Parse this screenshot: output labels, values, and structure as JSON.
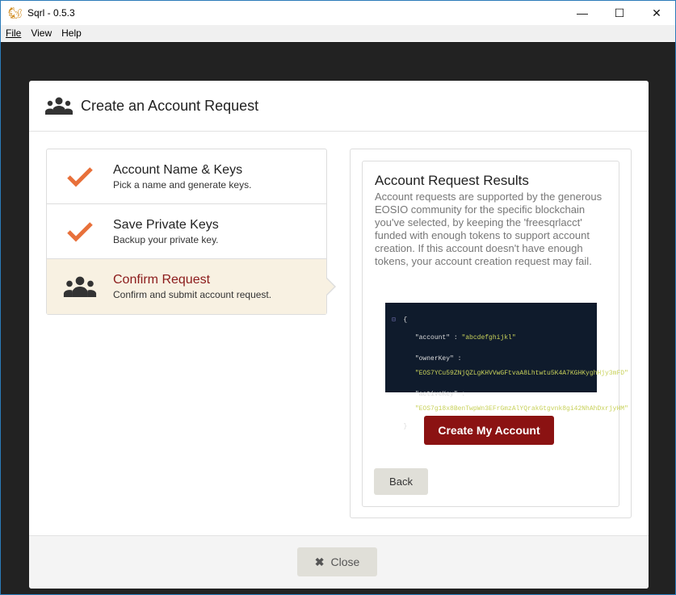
{
  "window": {
    "title": "Sqrl - 0.5.3",
    "minimize": "—",
    "maximize": "☐",
    "close": "✕"
  },
  "menu": [
    "File",
    "View",
    "Help"
  ],
  "modal": {
    "title": "Create an Account Request",
    "steps": [
      {
        "title": "Account Name & Keys",
        "desc": "Pick a name and generate keys.",
        "status": "done"
      },
      {
        "title": "Save Private Keys",
        "desc": "Backup your private key.",
        "status": "done"
      },
      {
        "title": "Confirm Request",
        "desc": "Confirm and submit account request.",
        "status": "active"
      }
    ],
    "results": {
      "title": "Account Request Results",
      "body": "Account requests are supported by the generous EOSIO community for the specific blockchain you've selected, by keeping the 'freesqrlacct' funded with enough tokens to support account creation. If this account doesn't have enough tokens, your account creation request may fail.",
      "json": {
        "account_key": "\"account\"",
        "account": "\"abcdefghijkl\"",
        "owner_key_label": "\"ownerKey\"",
        "ownerKey": "\"EOS7YCu59ZNjQZLgKHVVwGFtvaA8Lhtwtu5K4A7KGHKyghHjy3mFD\"",
        "active_key_label": "\"activeKey\"",
        "activeKey": "\"EOS7g18x8BenTwpWn3EFrGmzAlYQrakGtgvnk8gi42NhAhDxrjyHM\""
      },
      "create_label": "Create My Account",
      "back_label": "Back"
    },
    "close_label": "Close"
  },
  "colors": {
    "accent": "#8b1212",
    "check": "#e8703a"
  }
}
